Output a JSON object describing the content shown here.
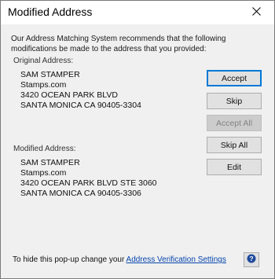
{
  "window": {
    "title": "Modified Address",
    "close_icon": "close-icon"
  },
  "intro_text": "Our Address Matching System recommends that the following modifications be made to the address that you provided:",
  "original": {
    "label": "Original Address:",
    "lines": [
      "SAM STAMPER",
      "Stamps.com",
      "3420 OCEAN PARK BLVD",
      "SANTA MONICA CA 90405-3304"
    ]
  },
  "modified": {
    "label": "Modified Address:",
    "lines": [
      "SAM STAMPER",
      "Stamps.com",
      "3420 OCEAN PARK BLVD STE 3060",
      "SANTA MONICA CA 90405-3306"
    ]
  },
  "buttons": {
    "accept": "Accept",
    "skip": "Skip",
    "accept_all": "Accept All",
    "skip_all": "Skip All",
    "edit": "Edit"
  },
  "footer": {
    "text": "To hide this pop-up change your ",
    "link": "Address Verification Settings",
    "help_icon": "help-icon"
  },
  "colors": {
    "accent": "#0078d7",
    "link": "#0645ad",
    "background": "#f0f0f0",
    "help_icon": "#1e4a9c"
  }
}
